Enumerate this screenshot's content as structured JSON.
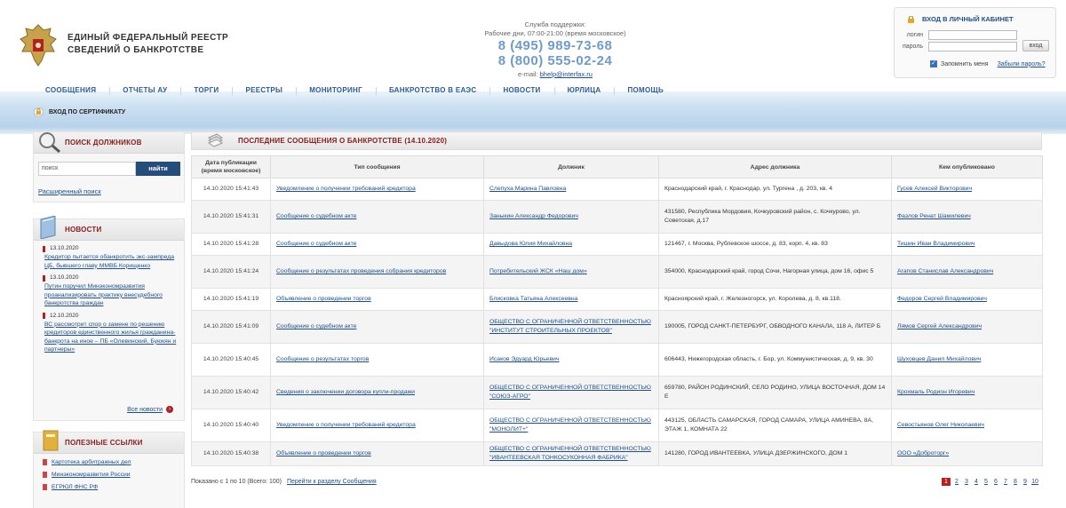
{
  "header": {
    "site_title_line1": "ЕДИНЫЙ ФЕДЕРАЛЬНЫЙ РЕЕСТР",
    "site_title_line2": "СВЕДЕНИЙ О БАНКРОТСТВЕ",
    "support_label": "Служба поддержки:",
    "support_hours": "Рабочие дни, 07:00-21:00 (время московское)",
    "phone1": "8 (495) 989-73-68",
    "phone2": "8 (800) 555-02-24",
    "email_label": "e-mail:",
    "email": "bhelp@interfax.ru"
  },
  "login": {
    "title": "ВХОД В ЛИЧНЫЙ КАБИНЕТ",
    "login_label": "логин",
    "password_label": "пароль",
    "submit": "вход",
    "remember": "Запомнить меня",
    "forgot": "Забыли пароль?"
  },
  "nav": [
    "СООБЩЕНИЯ",
    "ОТЧЕТЫ АУ",
    "ТОРГИ",
    "РЕЕСТРЫ",
    "МОНИТОРИНГ",
    "БАНКРОТСТВО В ЕАЭС",
    "НОВОСТИ",
    "ЮРЛИЦА",
    "ПОМОЩЬ"
  ],
  "cert_login": "ВХОД ПО СЕРТИФИКАТУ",
  "search_panel": {
    "title": "ПОИСК ДОЛЖНИКОВ",
    "value": "поиск",
    "button": "найти",
    "advanced": "Расширенный поиск"
  },
  "news_panel": {
    "title": "НОВОСТИ",
    "items": [
      {
        "date": "13.10.2020",
        "text": "Кредитор пытается обанкротить экс-зампреда ЦБ, бывшего главу ММВБ Корищенко"
      },
      {
        "date": "13.10.2020",
        "text": "Путин поручил Минэкономразвития проанализировать практику внесудебного банкротства граждан"
      },
      {
        "date": "12.10.2020",
        "text": "ВС рассмотрит спор о замене по решению кредиторов единственного жилья гражданина-банкрота на иное – ПБ «Олевинский, Буюкян и партнеры»"
      }
    ],
    "all": "Все новости"
  },
  "links_panel": {
    "title": "ПОЛЕЗНЫЕ ССЫЛКИ",
    "items": [
      "Картотека арбитражных дел",
      "Минэкономразвития России",
      "ЕГРЮЛ ФНС РФ"
    ]
  },
  "main": {
    "title": "ПОСЛЕДНИЕ СООБЩЕНИЯ О БАНКРОТСТВЕ (14.10.2020)",
    "columns": {
      "date_line1": "Дата публикации",
      "date_line2": "(время московское)",
      "type": "Тип сообщения",
      "debtor": "Должник",
      "address": "Адрес должника",
      "publisher": "Кем опубликовано"
    },
    "rows": [
      {
        "date": "14.10.2020 15:41:43",
        "type": "Уведомление о получении требований кредитора",
        "debtor": "Слепуха Марина Павловна",
        "address": "Краснодарский край, г. Краснодар, ул. Тургена , д. 203, кв. 4",
        "publisher": "Гусев Алексей Викторович"
      },
      {
        "date": "14.10.2020 15:41:31",
        "type": "Сообщение о судебном акте",
        "debtor": "Заныкин Александр Федорович",
        "address": "431580, Республика Мордовия, Кочкуровский район, с. Кочкурово, ул. Советская, д.17",
        "publisher": "Фазлов Ренат Шамилевич"
      },
      {
        "date": "14.10.2020 15:41:28",
        "type": "Сообщение о судебном акте",
        "debtor": "Давыдова Юлия Михайловна",
        "address": "121467, г. Москва, Рублевское шоссе, д. 83, корп. 4, кв. 83",
        "publisher": "Тишин Иван Владимирович"
      },
      {
        "date": "14.10.2020 15:41:24",
        "type": "Сообщение о результатах проведения собрания кредиторов",
        "debtor": "Потребительский ЖСК «Наш дом»",
        "address": "354000, Краснодарский край, город Сочи, Нагорная улица, дом 16, офис 5",
        "publisher": "Агапов Станислав Александрович"
      },
      {
        "date": "14.10.2020 15:41:19",
        "type": "Объявление о проведении торгов",
        "debtor": "Блисковка Татьяна Алексеевна",
        "address": "Красноярский край, г. Железногорск, ул. Королева, д. 8, кв.118.",
        "publisher": "Федоров Сергей Владимирович"
      },
      {
        "date": "14.10.2020 15:41:09",
        "type": "Сообщение о судебном акте",
        "debtor": "ОБЩЕСТВО С ОГРАНИЧЕННОЙ ОТВЕТСТВЕННОСТЬЮ \"ИНСТИТУТ СТРОИТЕЛЬНЫХ ПРОЕКТОВ\"",
        "address": "190005, ГОРОД САНКТ-ПЕТЕРБУРГ, ОБВОДНОГО КАНАЛА, 118 А, ЛИТЕР Б",
        "publisher": "Лямов Сергей Александрович"
      },
      {
        "date": "14.10.2020 15:40:45",
        "type": "Сообщение о результатах торгов",
        "debtor": "Исаков Эдуард Юрьевич",
        "address": "606443, Нижегородская область, г. Бор, ул. Коммунистическая, д. 9, кв. 30",
        "publisher": "Шуховцев Данил Михайлович"
      },
      {
        "date": "14.10.2020 15:40:42",
        "type": "Сведения о заключении договора купли-продажи",
        "debtor": "ОБЩЕСТВО С ОГРАНИЧЕННОЙ ОТВЕТСТВЕННОСТЬЮ \"СОЮЗ-АГРО\"",
        "address": "659780, РАЙОН РОДИНСКИЙ, СЕЛО РОДИНО, УЛИЦА ВОСТОЧНАЯ, ДОМ 14 Е",
        "publisher": "Крохмаль Родион Игоревич"
      },
      {
        "date": "14.10.2020 15:40:40",
        "type": "Уведомление о получении требований кредитора",
        "debtor": "ОБЩЕСТВО С ОГРАНИЧЕННОЙ ОТВЕТСТВЕННОСТЬЮ \"МОНОЛИТ+\"",
        "address": "443125, ОБЛАСТЬ САМАРСКАЯ, ГОРОД САМАРА, УЛИЦА АМИНЕВА, 8А, ЭТАЖ 1, КОМНАТА 22",
        "publisher": "Севостьянов Олег Николаевич"
      },
      {
        "date": "14.10.2020 15:40:38",
        "type": "Объявление о проведении торгов",
        "debtor": "ОБЩЕСТВО С ОГРАНИЧЕННОЙ ОТВЕТСТВЕННОСТЬЮ \"ИВАНТЕЕВСКАЯ ТОНКОСУКОННАЯ ФАБРИКА\"",
        "address": "141280, ГОРОД ИВАНТЕЕВКА, УЛИЦА ДЗЕРЖИНСКОГО, ДОМ 1",
        "publisher": "ООО «Доброторг»"
      }
    ],
    "shown": "Показано с 1 по 10 (Всего: 100)",
    "goto": "Перейти к разделу Сообщения",
    "pages": [
      "1",
      "2",
      "3",
      "4",
      "5",
      "6",
      "7",
      "8",
      "9",
      "10"
    ],
    "active_page": "1"
  }
}
